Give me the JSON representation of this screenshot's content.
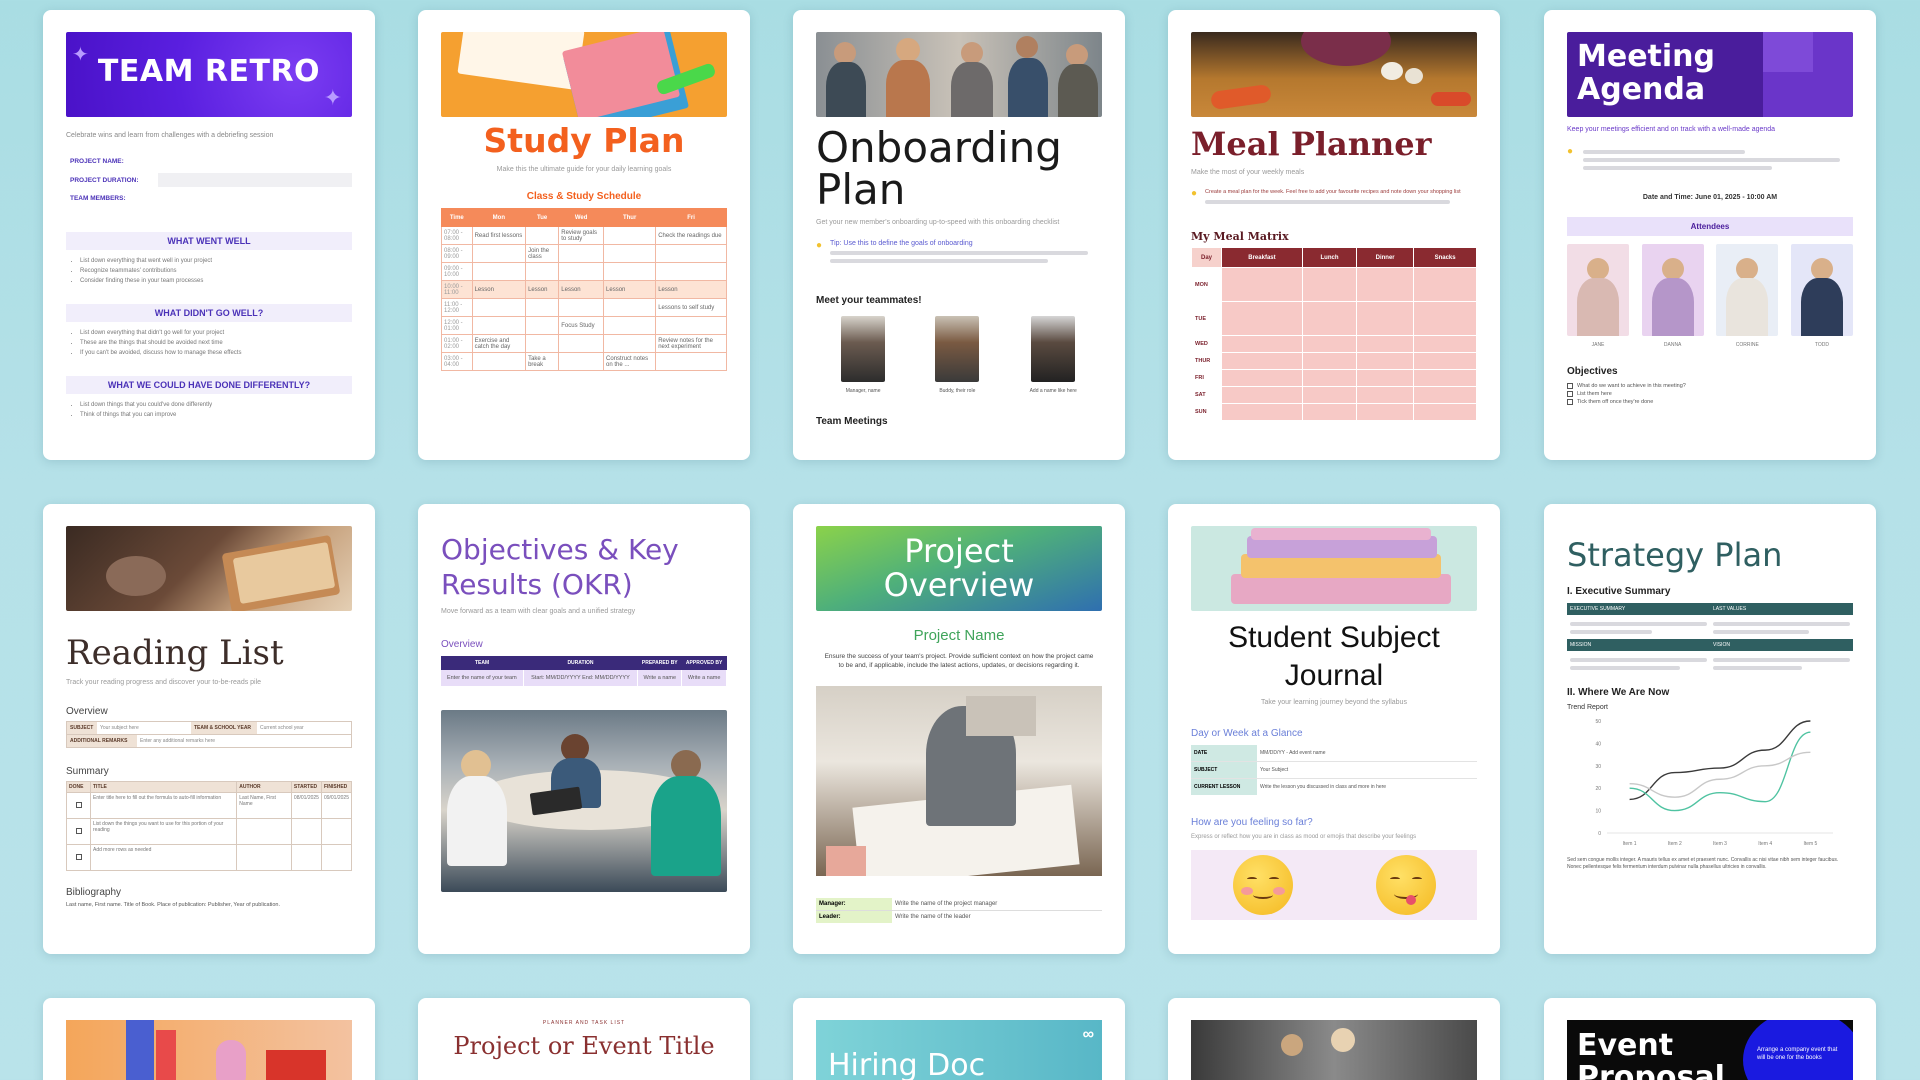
{
  "cards": {
    "team_retro": {
      "title": "TEAM RETRO",
      "subtitle": "Celebrate wins and learn from challenges with a debriefing session",
      "field_project_name": "PROJECT NAME:",
      "field_project_duration": "PROJECT DURATION:",
      "field_team_members": "TEAM MEMBERS:",
      "section_went_well": "WHAT WENT WELL",
      "section_didnt_go_well": "WHAT DIDN'T GO WELL?",
      "section_differently": "WHAT WE COULD HAVE DONE DIFFERENTLY?",
      "bullets_well": [
        "List down everything that went well in your project",
        "Recognize teammates' contributions",
        "Consider finding these in your team processes"
      ],
      "bullets_bad": [
        "List down everything that didn't go well for your project",
        "These are the things that should be avoided next time",
        "If you can't be avoided, discuss how to manage these effects"
      ],
      "bullets_diff": [
        "List down things that you could've done differently",
        "Think of things that you can improve"
      ]
    },
    "study_plan": {
      "title": "Study Plan",
      "subtitle": "Make this the ultimate guide for your daily learning goals",
      "section": "Class & Study Schedule",
      "columns": [
        "Time",
        "Mon",
        "Tue",
        "Wed",
        "Thur",
        "Fri"
      ],
      "rows": [
        [
          "07:00 - 08:00",
          "Read first lessons",
          "",
          "Review goals to study",
          "",
          "Check the readings due"
        ],
        [
          "08:00 - 09:00",
          "",
          "Join the class",
          "",
          "",
          ""
        ],
        [
          "09:00 - 10:00",
          "",
          "",
          "",
          "",
          ""
        ],
        [
          "10:00 - 11:00",
          "Lesson",
          "Lesson",
          "Lesson",
          "Lesson",
          "Lesson"
        ],
        [
          "11:00 - 12:00",
          "",
          "",
          "",
          "",
          "Lessons to self study"
        ],
        [
          "12:00 - 01:00",
          "",
          "",
          "Focus Study",
          "",
          ""
        ],
        [
          "01:00 - 02:00",
          "Exercise and catch the day",
          "",
          "",
          "",
          "Review notes for the next experiment"
        ],
        [
          "03:00 - 04:00",
          "",
          "Take a break",
          "",
          "Construct notes on the ...",
          ""
        ]
      ]
    },
    "onboarding": {
      "title": "Onboarding Plan",
      "subtitle": "Get your new member's onboarding up-to-speed with this onboarding checklist",
      "tip": "Tip: Use this to define the goals of onboarding",
      "meet": "Meet your teammates!",
      "teammates": [
        "Manager, name",
        "Buddy, their role",
        "Add a name like here"
      ],
      "meetings": "Team Meetings"
    },
    "meal_planner": {
      "title": "Meal Planner",
      "subtitle": "Make the most of your weekly meals",
      "tip": "Create a meal plan for the week. Feel free to add your favourite recipes and note down your shopping list",
      "matrix_title": "My Meal Matrix",
      "columns": [
        "Day",
        "Breakfast",
        "Lunch",
        "Dinner",
        "Snacks"
      ],
      "days": [
        "MON",
        "TUE",
        "WED",
        "THUR",
        "FRI",
        "SAT",
        "SUN"
      ]
    },
    "meeting_agenda": {
      "title": "Meeting Agenda",
      "subtitle": "Keep your meetings efficient and on track with a well-made agenda",
      "datetime": "Date and Time: June 01, 2025 - 10:00 AM",
      "attendees_label": "Attendees",
      "attendees": [
        "JANE",
        "DANNA",
        "CORRINE",
        "TODD"
      ],
      "objectives_label": "Objectives",
      "objectives": [
        "What do we want to achieve in this meeting?",
        "List them here",
        "Tick them off once they're done"
      ]
    },
    "reading_list": {
      "title": "Reading List",
      "subtitle": "Track your reading progress and discover your to-be-reads pile",
      "overview": "Overview",
      "f_subject": "SUBJECT",
      "f_subject_val": "Your subject here",
      "f_team": "TEAM & SCHOOL YEAR",
      "f_team_val": "Current school year",
      "f_remarks": "ADDITIONAL REMARKS",
      "f_remarks_val": "Enter any additional remarks here",
      "summary": "Summary",
      "columns": [
        "DONE",
        "TITLE",
        "AUTHOR",
        "STARTED",
        "FINISHED"
      ],
      "rows": [
        [
          "Enter title here to fill out the formula to auto-fill information",
          "Last Name, First Name",
          "08/01/2025",
          "09/01/2025"
        ],
        [
          "List down the things you want to use for this portion of your reading",
          "",
          "",
          ""
        ],
        [
          "Add more rows as needed",
          "",
          "",
          ""
        ]
      ],
      "bibliography": "Bibliography",
      "bib_line": "Last name, First name. Title of Book. Place of publication: Publisher, Year of publication."
    },
    "okr": {
      "title": "Objectives & Key Results (OKR)",
      "subtitle": "Move forward as a team with clear goals and a unified strategy",
      "overview": "Overview",
      "columns": [
        "TEAM",
        "DURATION",
        "PREPARED BY",
        "APPROVED BY"
      ],
      "values": [
        "Enter the name of your team",
        "Start: MM/DD/YYYY End: MM/DD/YYYY",
        "Write a name",
        "Write a name"
      ]
    },
    "project_overview": {
      "banner": "Project Overview",
      "name_label": "Project Name",
      "description": "Ensure the success of your team's project. Provide sufficient context on how the project came to be and, if applicable, include the latest actions, updates, or decisions regarding it.",
      "manager_label": "Manager:",
      "manager_val": "Write the name of the project manager",
      "leader_label": "Leader:",
      "leader_val": "Write the name of the leader"
    },
    "student_journal": {
      "title": "Student Subject Journal",
      "subtitle": "Take your learning journey beyond the syllabus",
      "glance": "Day or Week at a Glance",
      "f_date": "DATE",
      "f_date_val": "MM/DD/YY - Add event name",
      "f_subject": "SUBJECT",
      "f_subject_val": "Your Subject",
      "f_lesson": "CURRENT LESSON",
      "f_lesson_val": "Write the lesson you discussed in class and more in here",
      "feeling": "How are you feeling so far?",
      "feeling_sub": "Express or reflect how you are in class as mood or emojis that describe your feelings"
    },
    "strategy_plan": {
      "title": "Strategy Plan",
      "section1": "I. Executive Summary",
      "h1": "EXECUTIVE SUMMARY",
      "h2": "LAST VALUES",
      "h3": "MISSION",
      "h4": "VISION",
      "section2": "II. Where We Are Now",
      "trend": "Trend Report",
      "chart_data": {
        "type": "line",
        "categories": [
          "Item 1",
          "Item 2",
          "Item 3",
          "Item 4",
          "Item 5"
        ],
        "y_ticks": [
          0,
          10,
          20,
          30,
          40,
          50
        ],
        "series": [
          {
            "color": "#3a3a3a",
            "values": [
              15,
              27,
              29,
              37,
              50
            ]
          },
          {
            "color": "#4fc3a1",
            "values": [
              20,
              10,
              18,
              14,
              45
            ]
          },
          {
            "color": "#c8c8c8",
            "values": [
              22,
              16,
              24,
              30,
              36
            ]
          }
        ]
      },
      "footnote": "Sed sem congue mollis integer. A mauris tellus ex amet et praesent nunc. Convallis ac nisi vitae nibh sem integer faucibus. Nonec pellentesque felis fermentum interdum pulvinar nulla phasellus ultricies in convallis."
    },
    "row3": {
      "project_event_eyebrow": "PLANNER AND TASK LIST",
      "project_event_title": "Project or Event Title",
      "hiring_title": "Hiring Doc",
      "event_proposal_title": "Event Proposal",
      "event_proposal_blurb": "Arrange a company event that will be one for the books"
    }
  },
  "colors": {
    "retro_purple": "#5b1fe0",
    "study_orange": "#f3601e",
    "meal_maroon": "#7a1f2b",
    "agenda_purple": "#4a1d9c",
    "okr_purple": "#7a4fbd",
    "strategy_teal": "#2f5f61",
    "journal_blue": "#6a7fd8"
  }
}
